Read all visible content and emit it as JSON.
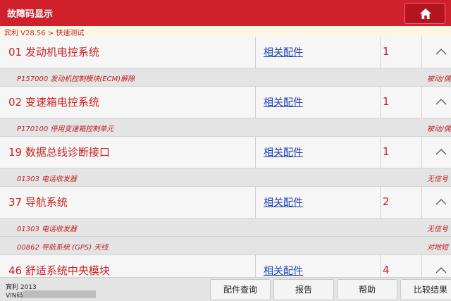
{
  "header": {
    "title": "故障码显示",
    "home_icon": "home-icon"
  },
  "breadcrumb": "宾利 V28.56 > 快速测试",
  "list": {
    "systems": [
      {
        "name": "01 发动机电控系统",
        "link": "相关配件",
        "count": "1",
        "codes": [
          {
            "text": "P157000 发动机控制模块(ECM)解除",
            "status": "被动/偶"
          }
        ]
      },
      {
        "name": "02 变速箱电控系统",
        "link": "相关配件",
        "count": "1",
        "codes": [
          {
            "text": "P170100 停用变速箱控制单元",
            "status": "被动/偶"
          }
        ]
      },
      {
        "name": "19 数据总线诊断接口",
        "link": "相关配件",
        "count": "1",
        "codes": [
          {
            "text": "01303 电话收发器",
            "status": "无信号"
          }
        ]
      },
      {
        "name": "37 导航系统",
        "link": "相关配件",
        "count": "2",
        "codes": [
          {
            "text": "01303 电话收发器",
            "status": "无信号"
          },
          {
            "text": "00862 导航系统 (GPS) 天线",
            "status": "对地短"
          }
        ]
      },
      {
        "name": "46 舒适系统中央模块",
        "link": "相关配件",
        "count": "4",
        "codes": []
      }
    ]
  },
  "footer": {
    "vehicle": "宾利 2013",
    "vin_label": "VIN码",
    "buttons": [
      "配件查询",
      "报告",
      "帮助",
      "比较结果"
    ]
  },
  "colors": {
    "header": "#d0202c",
    "accent_text": "#cc2222",
    "link": "#1b3fb5"
  }
}
